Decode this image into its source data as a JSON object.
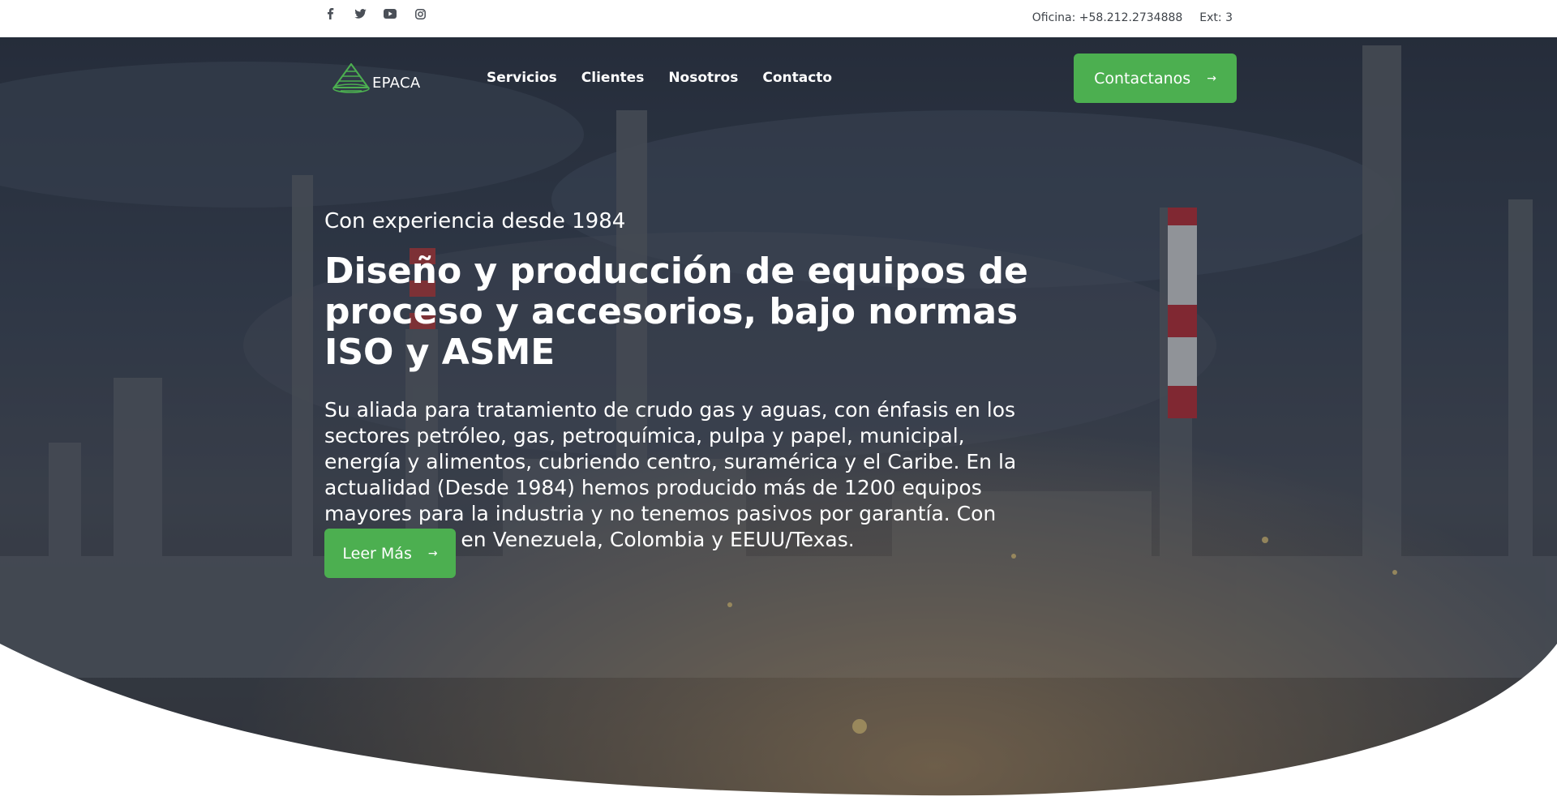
{
  "topbar": {
    "social": [
      "facebook-icon",
      "twitter-icon",
      "youtube-icon",
      "instagram-icon"
    ],
    "phone": "Oficina: +58.212.2734888",
    "ext": "Ext: 3"
  },
  "brand": {
    "name": "EPACA",
    "logo_color": "#4caf50"
  },
  "nav": {
    "items": [
      "Servicios",
      "Clientes",
      "Nosotros",
      "Contacto"
    ],
    "cta": "Contactanos"
  },
  "hero": {
    "eyebrow": "Con experiencia desde 1984",
    "headline": "Diseño y producción de equipos de proceso y accesorios, bajo normas ISO y ASME",
    "lead": "Su aliada para tratamiento de crudo gas y aguas, con énfasis en los sectores petróleo, gas, petroquímica, pulpa y papel, municipal, energía y alimentos, cubriendo centro, suramérica y el Caribe. En la actualidad (Desde 1984) hemos producido más de 1200 equipos mayores para la industria y no tenemos pasivos por garantía. Con manufactura en Venezuela, Colombia y EEUU/Texas.",
    "button": "Leer Más"
  },
  "colors": {
    "accent": "#4caf50",
    "text_dark": "#3f444a"
  }
}
